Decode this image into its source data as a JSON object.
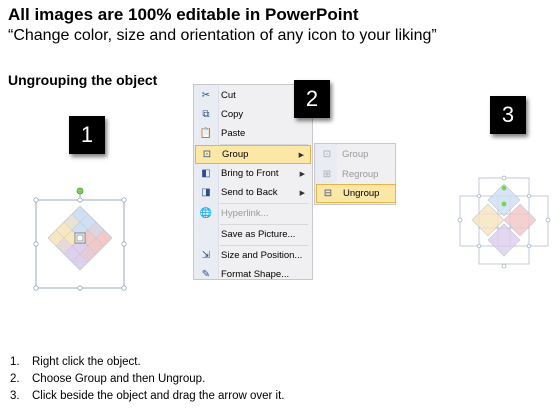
{
  "header": {
    "title": "All images are 100% editable in PowerPoint",
    "subtitle": "“Change color, size and orientation of any icon to your liking”",
    "section": "Ungrouping the object"
  },
  "badges": [
    "1",
    "2",
    "3"
  ],
  "context_menu": {
    "items": [
      {
        "label": "Cut",
        "icon": "scissors-icon",
        "enabled": true
      },
      {
        "label": "Copy",
        "icon": "copy-icon",
        "enabled": true
      },
      {
        "label": "Paste",
        "icon": "paste-icon",
        "enabled": true
      },
      {
        "label": "Group",
        "icon": "group-icon",
        "enabled": true,
        "submenu": true,
        "highlighted": true
      },
      {
        "label": "Bring to Front",
        "icon": "bring-to-front-icon",
        "enabled": true,
        "submenu": true
      },
      {
        "label": "Send to Back",
        "icon": "send-to-back-icon",
        "enabled": true,
        "submenu": true
      },
      {
        "label": "Hyperlink...",
        "icon": "hyperlink-icon",
        "enabled": false
      },
      {
        "label": "Save as Picture...",
        "icon": "",
        "enabled": true
      },
      {
        "label": "Size and Position...",
        "icon": "size-position-icon",
        "enabled": true
      },
      {
        "label": "Format Shape...",
        "icon": "format-shape-icon",
        "enabled": true
      }
    ]
  },
  "submenu": {
    "items": [
      {
        "label": "Group",
        "icon": "group-icon",
        "enabled": false
      },
      {
        "label": "Regroup",
        "icon": "regroup-icon",
        "enabled": false
      },
      {
        "label": "Ungroup",
        "icon": "ungroup-icon",
        "enabled": true,
        "highlighted": true
      }
    ]
  },
  "steps": [
    {
      "num": "1.",
      "text": "Right click the object."
    },
    {
      "num": "2.",
      "text": "Choose Group and then Ungroup."
    },
    {
      "num": "3.",
      "text": "Click beside the object and drag the arrow over it."
    }
  ],
  "colors": {
    "blue": "#cfe0f3",
    "red": "#f2c9c9",
    "purple": "#ddd0ee",
    "yellow": "#f7e6c2",
    "highlight": "#fde7a6",
    "menu_bg": "#f0f0f2"
  }
}
